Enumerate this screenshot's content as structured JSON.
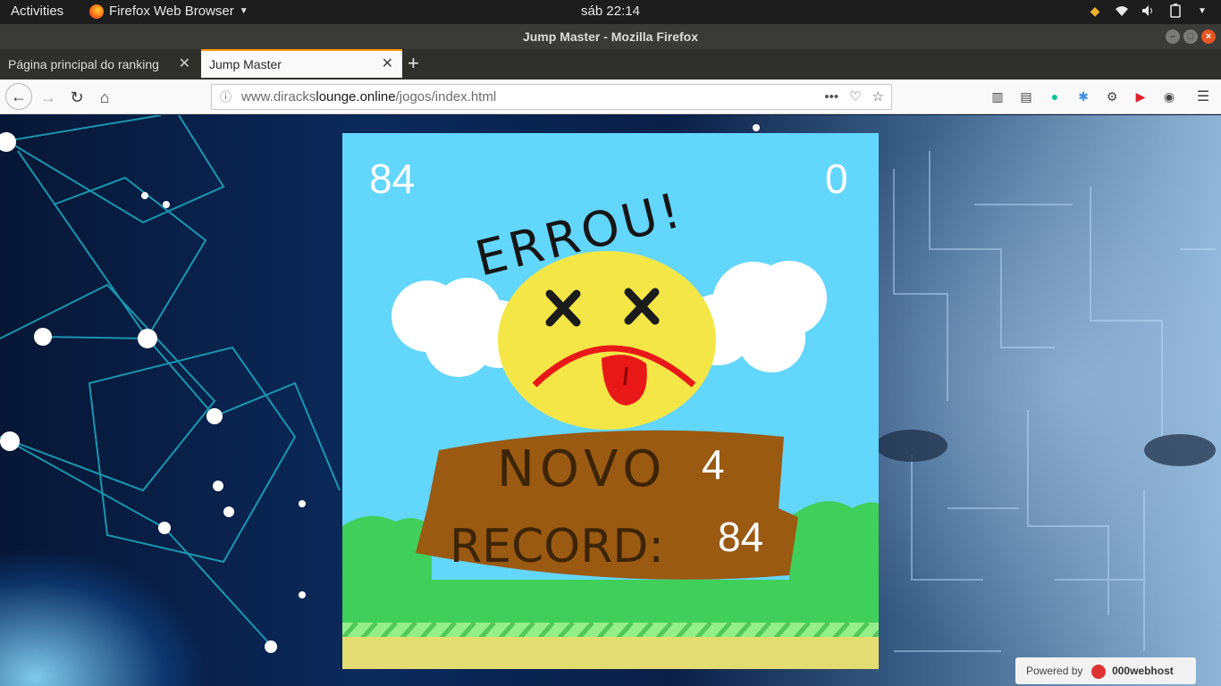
{
  "topbar": {
    "activities": "Activities",
    "app_name": "Firefox Web Browser",
    "clock": "sáb 22:14"
  },
  "window": {
    "title": "Jump Master - Mozilla Firefox"
  },
  "tabs": [
    {
      "label": "Página principal do ranking",
      "active": false
    },
    {
      "label": "Jump Master",
      "active": true
    }
  ],
  "navbar": {
    "url_domain": "www.diracks",
    "url_host_bold": "lounge.online",
    "url_path": "/jogos/index.html"
  },
  "game": {
    "score_left": "84",
    "score_right": "0",
    "banner_text": "ERROU!",
    "sign_line1": "NOVO",
    "sign_line2": "RECORD:",
    "sign_value1": "4",
    "sign_value2": "84",
    "colors": {
      "sky": "#63d6fb",
      "sign": "#9a5a12",
      "ground": "#e3dc72",
      "bush": "#3fcf5a"
    }
  },
  "footer_badge": {
    "powered_by": "Powered by",
    "brand": "000webhost"
  }
}
